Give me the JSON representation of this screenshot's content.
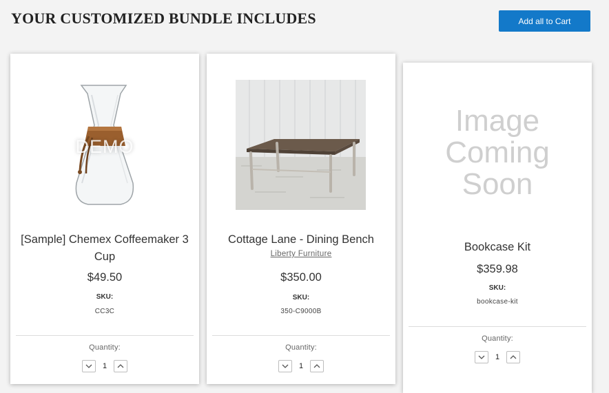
{
  "header": {
    "title": "YOUR CUSTOMIZED BUNDLE INCLUDES",
    "add_all_label": "Add all to Cart"
  },
  "products": [
    {
      "name": "[Sample] Chemex Coffeemaker 3 Cup",
      "brand": "",
      "price": "$49.50",
      "sku_label": "SKU:",
      "sku": "CC3C",
      "image_watermark": "DEMO",
      "quantity_label": "Quantity:",
      "quantity": "1"
    },
    {
      "name": "Cottage Lane - Dining Bench",
      "brand": "Liberty Furniture",
      "price": "$350.00",
      "sku_label": "SKU:",
      "sku": "350-C9000B",
      "quantity_label": "Quantity:",
      "quantity": "1"
    },
    {
      "name": "Bookcase Kit",
      "brand": "",
      "price": "$359.98",
      "sku_label": "SKU:",
      "sku": "bookcase-kit",
      "image_placeholder": [
        "Image",
        "Coming",
        "Soon"
      ],
      "quantity_label": "Quantity:",
      "quantity": "1"
    }
  ],
  "colors": {
    "accent": "#1379c9",
    "page_background": "#f3f3f3",
    "card_background": "#ffffff"
  },
  "icons": {
    "decrement": "chevron-down-icon",
    "increment": "chevron-up-icon"
  }
}
